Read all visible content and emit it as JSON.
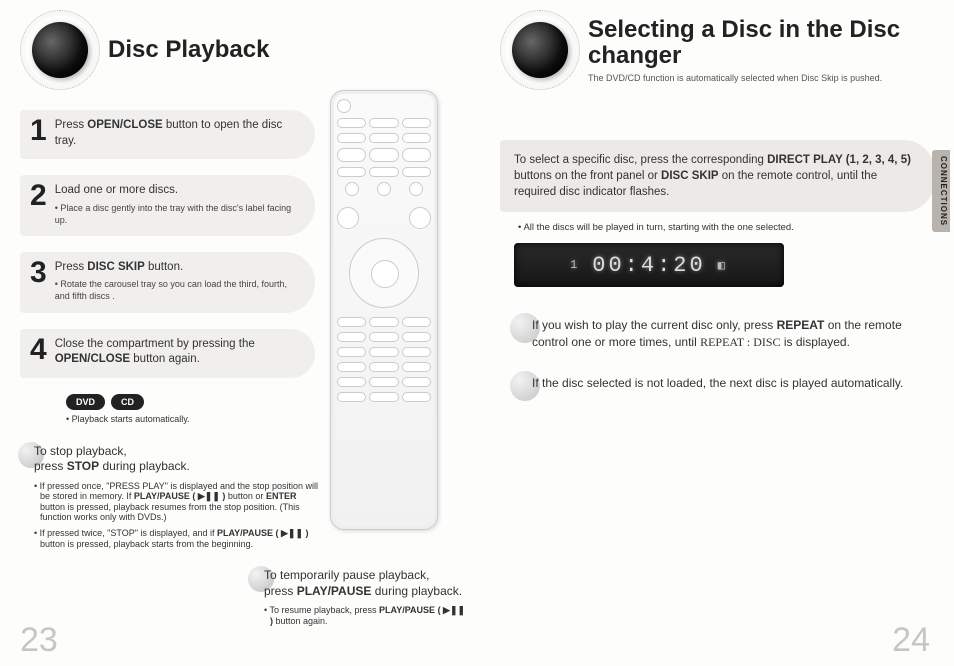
{
  "left": {
    "title": "Disc Playback",
    "steps": [
      {
        "num": "1",
        "html": "Press <b>OPEN/CLOSE</b> button to open the disc tray."
      },
      {
        "num": "2",
        "html": "Load one or more discs.",
        "sub": "• Place a disc gently into the tray with the disc's label facing up."
      },
      {
        "num": "3",
        "html": "Press <b>DISC SKIP</b> button.",
        "sub": "• Rotate the carousel tray so you can load the third, fourth, and fifth discs ."
      },
      {
        "num": "4",
        "html": "Close the compartment by pressing the <b>OPEN/CLOSE</b> button again."
      }
    ],
    "badges": [
      "DVD",
      "CD"
    ],
    "auto_play": "Playback starts automatically.",
    "stop": {
      "head": "To stop playback,<br>press <b>STOP</b> during playback.",
      "b1": "If pressed once, \"PRESS PLAY\" is displayed and the stop position will be stored in memory. If <b>PLAY/PAUSE ( ▶❚❚ )</b> button or <b>ENTER</b> button is pressed, playback resumes from the stop position. (This function works only with DVDs.)",
      "b2": "If pressed twice, \"STOP\" is displayed, and if <b>PLAY/PAUSE ( ▶❚❚ )</b> button is pressed, playback starts from the beginning."
    },
    "pause": {
      "head": "To temporarily pause playback,<br>press <b>PLAY/PAUSE</b> during playback.",
      "b1": "To resume playback, press <b>PLAY/PAUSE ( ▶❚❚ )</b> button again."
    },
    "page_num": "23"
  },
  "right": {
    "title": "Selecting a Disc in the Disc changer",
    "subtitle": "The DVD/CD function is automatically selected when Disc Skip is pushed.",
    "info_html": "To select a specific disc, press the corresponding <b>DIRECT PLAY (1, 2, 3, 4, 5)</b> buttons on the front panel or <b>DISC SKIP</b> on the remote control, until the required disc indicator flashes.",
    "all_discs": "All the discs will be played in turn, starting with the one selected.",
    "display_left": "1",
    "display_time": "00:4:20",
    "note1_html": "If you wish to play the current disc only, press <b>REPEAT</b> on the remote control one or more times, until <span class='serif'>REPEAT : DISC</span> is displayed.",
    "note2": "If the disc selected is not loaded, the next disc is played automatically.",
    "side_tab": "CONNECTIONS",
    "page_num": "24"
  }
}
